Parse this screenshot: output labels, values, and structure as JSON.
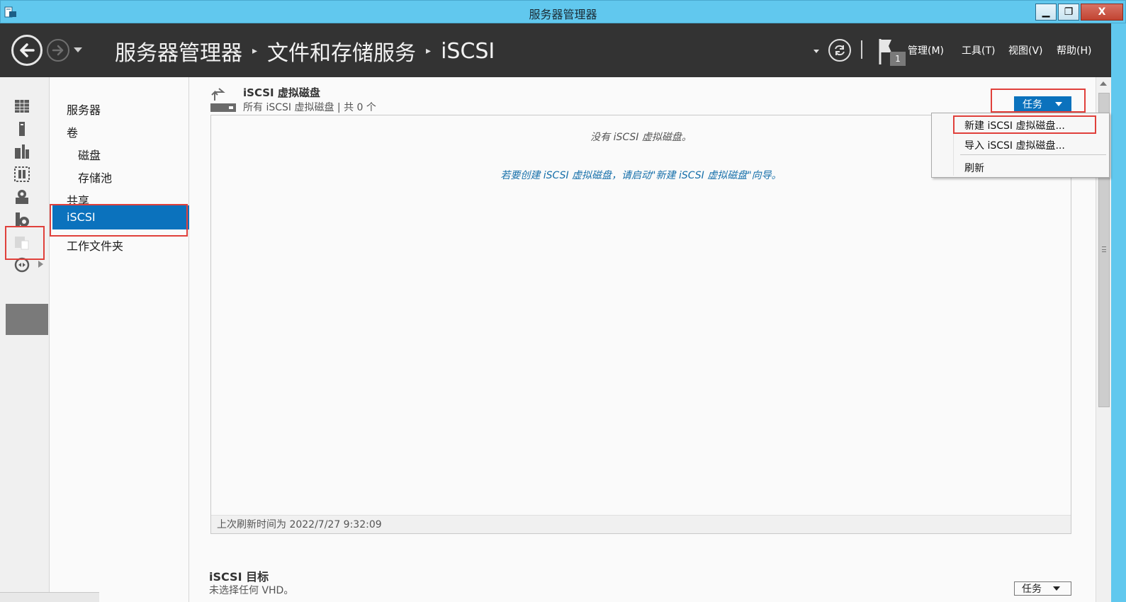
{
  "window": {
    "title": "服务器管理器",
    "min_label": "▁",
    "max_label": "❐",
    "close_label": "X"
  },
  "header": {
    "breadcrumb": [
      "服务器管理器",
      "文件和存储服务",
      "iSCSI"
    ],
    "separator": "▸",
    "notification_count": "1",
    "menus": [
      {
        "label": "管理(M)"
      },
      {
        "label": "工具(T)"
      },
      {
        "label": "视图(V)"
      },
      {
        "label": "帮助(H)"
      }
    ]
  },
  "nav": {
    "items": [
      {
        "label": "服务器"
      },
      {
        "label": "卷"
      },
      {
        "label": "磁盘"
      },
      {
        "label": "存储池"
      },
      {
        "label": "共享"
      },
      {
        "label": "iSCSI"
      },
      {
        "label": "工作文件夹"
      }
    ],
    "selected": "iSCSI"
  },
  "section": {
    "title": "iSCSI 虚拟磁盘",
    "subtitle": "所有 iSCSI 虚拟磁盘 | 共 0 个",
    "tasks_label": "任务",
    "empty_message": "没有 iSCSI 虚拟磁盘。",
    "hint_message": "若要创建 iSCSI 虚拟磁盘，请启动\"新建 iSCSI 虚拟磁盘\"向导。",
    "last_refresh": "上次刷新时间为 2022/7/27 9:32:09"
  },
  "dropdown": {
    "items": [
      {
        "label": "新建 iSCSI 虚拟磁盘..."
      },
      {
        "label": "导入 iSCSI 虚拟磁盘..."
      },
      {
        "label": "刷新"
      }
    ]
  },
  "section2": {
    "title": "iSCSI 目标",
    "subtitle": "未选择任何 VHD。",
    "tasks_label": "任务"
  },
  "colors": {
    "titlebar": "#61c8ee",
    "header": "#333333",
    "accent": "#0b72bd",
    "highlight": "#e0403b"
  }
}
